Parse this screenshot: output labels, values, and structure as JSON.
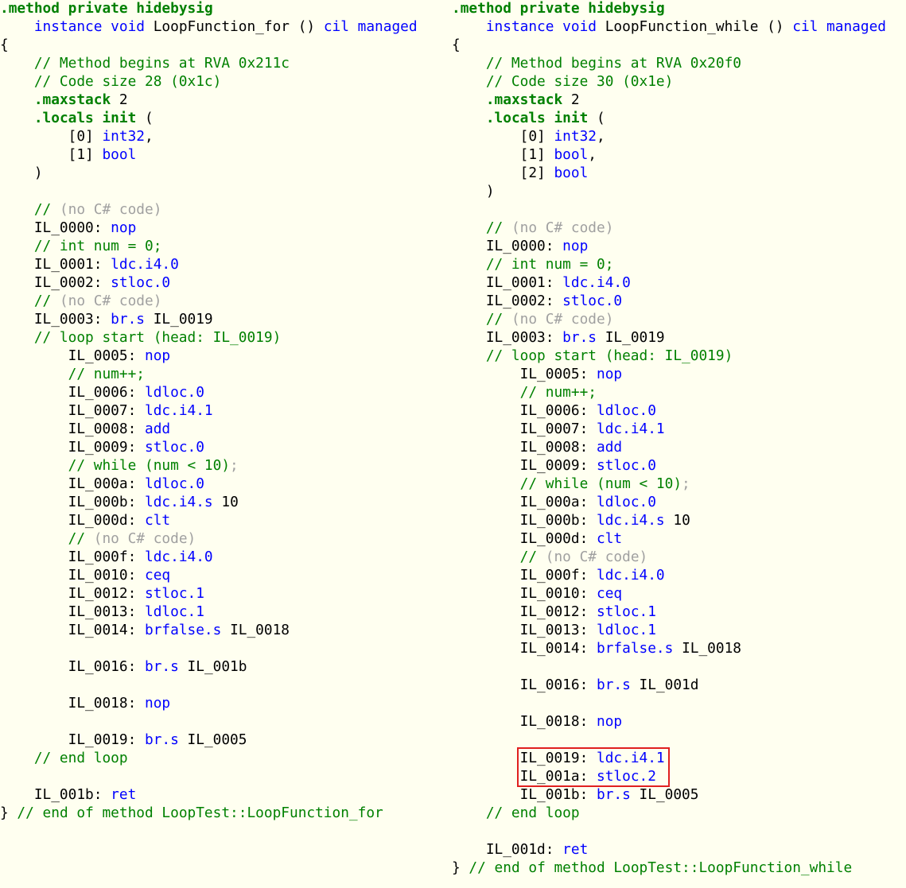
{
  "accent_colors": {
    "directive": "#008000",
    "keyword": "#0000FF",
    "comment": "#008000",
    "muted": "#A0A0A0",
    "plain": "#000000",
    "background": "#FFFFF0",
    "highlight": "#E02020"
  },
  "panes": [
    {
      "id": "loop-function-for",
      "lines": [
        [
          [
            "dir",
            ".method"
          ],
          [
            "plain",
            " "
          ],
          [
            "dir",
            "private hidebysig"
          ]
        ],
        [
          [
            "plain",
            "    "
          ],
          [
            "kw",
            "instance void"
          ],
          [
            "plain",
            " LoopFunction_for () "
          ],
          [
            "kw",
            "cil managed"
          ]
        ],
        [
          [
            "plain",
            "{"
          ]
        ],
        [
          [
            "com",
            "    // Method begins at RVA 0x211c"
          ]
        ],
        [
          [
            "com",
            "    // Code size 28 (0x1c)"
          ]
        ],
        [
          [
            "plain",
            "    "
          ],
          [
            "dir",
            ".maxstack"
          ],
          [
            "plain",
            " 2"
          ]
        ],
        [
          [
            "plain",
            "    "
          ],
          [
            "dir",
            ".locals init"
          ],
          [
            "plain",
            " ("
          ]
        ],
        [
          [
            "plain",
            "        [0] "
          ],
          [
            "kw",
            "int32"
          ],
          [
            "plain",
            ","
          ]
        ],
        [
          [
            "plain",
            "        [1] "
          ],
          [
            "kw",
            "bool"
          ]
        ],
        [
          [
            "plain",
            "    )"
          ]
        ],
        [],
        [
          [
            "com",
            "    // "
          ],
          [
            "grey",
            "(no C# code)"
          ]
        ],
        [
          [
            "plain",
            "    IL_0000: "
          ],
          [
            "kw",
            "nop"
          ]
        ],
        [
          [
            "com",
            "    // int num = 0;"
          ]
        ],
        [
          [
            "plain",
            "    IL_0001: "
          ],
          [
            "kw",
            "ldc.i4.0"
          ]
        ],
        [
          [
            "plain",
            "    IL_0002: "
          ],
          [
            "kw",
            "stloc.0"
          ]
        ],
        [
          [
            "com",
            "    // "
          ],
          [
            "grey",
            "(no C# code)"
          ]
        ],
        [
          [
            "plain",
            "    IL_0003: "
          ],
          [
            "kw",
            "br.s"
          ],
          [
            "plain",
            " IL_0019"
          ]
        ],
        [
          [
            "com",
            "    // loop start (head: IL_0019)"
          ]
        ],
        [
          [
            "plain",
            "        IL_0005: "
          ],
          [
            "kw",
            "nop"
          ]
        ],
        [
          [
            "com",
            "        // num++;"
          ]
        ],
        [
          [
            "plain",
            "        IL_0006: "
          ],
          [
            "kw",
            "ldloc.0"
          ]
        ],
        [
          [
            "plain",
            "        IL_0007: "
          ],
          [
            "kw",
            "ldc.i4.1"
          ]
        ],
        [
          [
            "plain",
            "        IL_0008: "
          ],
          [
            "kw",
            "add"
          ]
        ],
        [
          [
            "plain",
            "        IL_0009: "
          ],
          [
            "kw",
            "stloc.0"
          ]
        ],
        [
          [
            "com",
            "        // while (num < 10)"
          ],
          [
            "grey",
            ";"
          ]
        ],
        [
          [
            "plain",
            "        IL_000a: "
          ],
          [
            "kw",
            "ldloc.0"
          ]
        ],
        [
          [
            "plain",
            "        IL_000b: "
          ],
          [
            "kw",
            "ldc.i4.s"
          ],
          [
            "plain",
            " 10"
          ]
        ],
        [
          [
            "plain",
            "        IL_000d: "
          ],
          [
            "kw",
            "clt"
          ]
        ],
        [
          [
            "com",
            "        // "
          ],
          [
            "grey",
            "(no C# code)"
          ]
        ],
        [
          [
            "plain",
            "        IL_000f: "
          ],
          [
            "kw",
            "ldc.i4.0"
          ]
        ],
        [
          [
            "plain",
            "        IL_0010: "
          ],
          [
            "kw",
            "ceq"
          ]
        ],
        [
          [
            "plain",
            "        IL_0012: "
          ],
          [
            "kw",
            "stloc.1"
          ]
        ],
        [
          [
            "plain",
            "        IL_0013: "
          ],
          [
            "kw",
            "ldloc.1"
          ]
        ],
        [
          [
            "plain",
            "        IL_0014: "
          ],
          [
            "kw",
            "brfalse.s"
          ],
          [
            "plain",
            " IL_0018"
          ]
        ],
        [],
        [
          [
            "plain",
            "        IL_0016: "
          ],
          [
            "kw",
            "br.s"
          ],
          [
            "plain",
            " IL_001b"
          ]
        ],
        [],
        [
          [
            "plain",
            "        IL_0018: "
          ],
          [
            "kw",
            "nop"
          ]
        ],
        [],
        [
          [
            "plain",
            "        IL_0019: "
          ],
          [
            "kw",
            "br.s"
          ],
          [
            "plain",
            " IL_0005"
          ]
        ],
        [
          [
            "com",
            "    // end loop"
          ]
        ],
        [],
        [
          [
            "plain",
            "    IL_001b: "
          ],
          [
            "kw",
            "ret"
          ]
        ],
        [
          [
            "plain",
            "} "
          ],
          [
            "com",
            "// end of method LoopTest::LoopFunction_for"
          ]
        ]
      ]
    },
    {
      "id": "loop-function-while",
      "lines": [
        [
          [
            "dir",
            ".method"
          ],
          [
            "plain",
            " "
          ],
          [
            "dir",
            "private hidebysig"
          ]
        ],
        [
          [
            "plain",
            "    "
          ],
          [
            "kw",
            "instance void"
          ],
          [
            "plain",
            " LoopFunction_while () "
          ],
          [
            "kw",
            "cil managed"
          ]
        ],
        [
          [
            "plain",
            "{"
          ]
        ],
        [
          [
            "com",
            "    // Method begins at RVA 0x20f0"
          ]
        ],
        [
          [
            "com",
            "    // Code size 30 (0x1e)"
          ]
        ],
        [
          [
            "plain",
            "    "
          ],
          [
            "dir",
            ".maxstack"
          ],
          [
            "plain",
            " 2"
          ]
        ],
        [
          [
            "plain",
            "    "
          ],
          [
            "dir",
            ".locals init"
          ],
          [
            "plain",
            " ("
          ]
        ],
        [
          [
            "plain",
            "        [0] "
          ],
          [
            "kw",
            "int32"
          ],
          [
            "plain",
            ","
          ]
        ],
        [
          [
            "plain",
            "        [1] "
          ],
          [
            "kw",
            "bool"
          ],
          [
            "plain",
            ","
          ]
        ],
        [
          [
            "plain",
            "        [2] "
          ],
          [
            "kw",
            "bool"
          ]
        ],
        [
          [
            "plain",
            "    )"
          ]
        ],
        [],
        [
          [
            "com",
            "    // "
          ],
          [
            "grey",
            "(no C# code)"
          ]
        ],
        [
          [
            "plain",
            "    IL_0000: "
          ],
          [
            "kw",
            "nop"
          ]
        ],
        [
          [
            "com",
            "    // int num = 0;"
          ]
        ],
        [
          [
            "plain",
            "    IL_0001: "
          ],
          [
            "kw",
            "ldc.i4.0"
          ]
        ],
        [
          [
            "plain",
            "    IL_0002: "
          ],
          [
            "kw",
            "stloc.0"
          ]
        ],
        [
          [
            "com",
            "    // "
          ],
          [
            "grey",
            "(no C# code)"
          ]
        ],
        [
          [
            "plain",
            "    IL_0003: "
          ],
          [
            "kw",
            "br.s"
          ],
          [
            "plain",
            " IL_0019"
          ]
        ],
        [
          [
            "com",
            "    // loop start (head: IL_0019)"
          ]
        ],
        [
          [
            "plain",
            "        IL_0005: "
          ],
          [
            "kw",
            "nop"
          ]
        ],
        [
          [
            "com",
            "        // num++;"
          ]
        ],
        [
          [
            "plain",
            "        IL_0006: "
          ],
          [
            "kw",
            "ldloc.0"
          ]
        ],
        [
          [
            "plain",
            "        IL_0007: "
          ],
          [
            "kw",
            "ldc.i4.1"
          ]
        ],
        [
          [
            "plain",
            "        IL_0008: "
          ],
          [
            "kw",
            "add"
          ]
        ],
        [
          [
            "plain",
            "        IL_0009: "
          ],
          [
            "kw",
            "stloc.0"
          ]
        ],
        [
          [
            "com",
            "        // while (num < 10)"
          ],
          [
            "grey",
            ";"
          ]
        ],
        [
          [
            "plain",
            "        IL_000a: "
          ],
          [
            "kw",
            "ldloc.0"
          ]
        ],
        [
          [
            "plain",
            "        IL_000b: "
          ],
          [
            "kw",
            "ldc.i4.s"
          ],
          [
            "plain",
            " 10"
          ]
        ],
        [
          [
            "plain",
            "        IL_000d: "
          ],
          [
            "kw",
            "clt"
          ]
        ],
        [
          [
            "com",
            "        // "
          ],
          [
            "grey",
            "(no C# code)"
          ]
        ],
        [
          [
            "plain",
            "        IL_000f: "
          ],
          [
            "kw",
            "ldc.i4.0"
          ]
        ],
        [
          [
            "plain",
            "        IL_0010: "
          ],
          [
            "kw",
            "ceq"
          ]
        ],
        [
          [
            "plain",
            "        IL_0012: "
          ],
          [
            "kw",
            "stloc.1"
          ]
        ],
        [
          [
            "plain",
            "        IL_0013: "
          ],
          [
            "kw",
            "ldloc.1"
          ]
        ],
        [
          [
            "plain",
            "        IL_0014: "
          ],
          [
            "kw",
            "brfalse.s"
          ],
          [
            "plain",
            " IL_0018"
          ]
        ],
        [],
        [
          [
            "plain",
            "        IL_0016: "
          ],
          [
            "kw",
            "br.s"
          ],
          [
            "plain",
            " IL_001d"
          ]
        ],
        [],
        [
          [
            "plain",
            "        IL_0018: "
          ],
          [
            "kw",
            "nop"
          ]
        ],
        [],
        [
          [
            "plain",
            "        IL_0019: "
          ],
          [
            "kw",
            "ldc.i4.1"
          ]
        ],
        [
          [
            "plain",
            "        IL_001a: "
          ],
          [
            "kw",
            "stloc.2"
          ]
        ],
        [
          [
            "plain",
            "        IL_001b: "
          ],
          [
            "kw",
            "br.s"
          ],
          [
            "plain",
            " IL_0005"
          ]
        ],
        [
          [
            "com",
            "    // end loop"
          ]
        ],
        [],
        [
          [
            "plain",
            "    IL_001d: "
          ],
          [
            "kw",
            "ret"
          ]
        ],
        [
          [
            "plain",
            "} "
          ],
          [
            "com",
            "// end of method LoopTest::LoopFunction_while"
          ]
        ]
      ],
      "highlighted_instructions": [
        "IL_0019",
        "IL_001a"
      ]
    }
  ]
}
